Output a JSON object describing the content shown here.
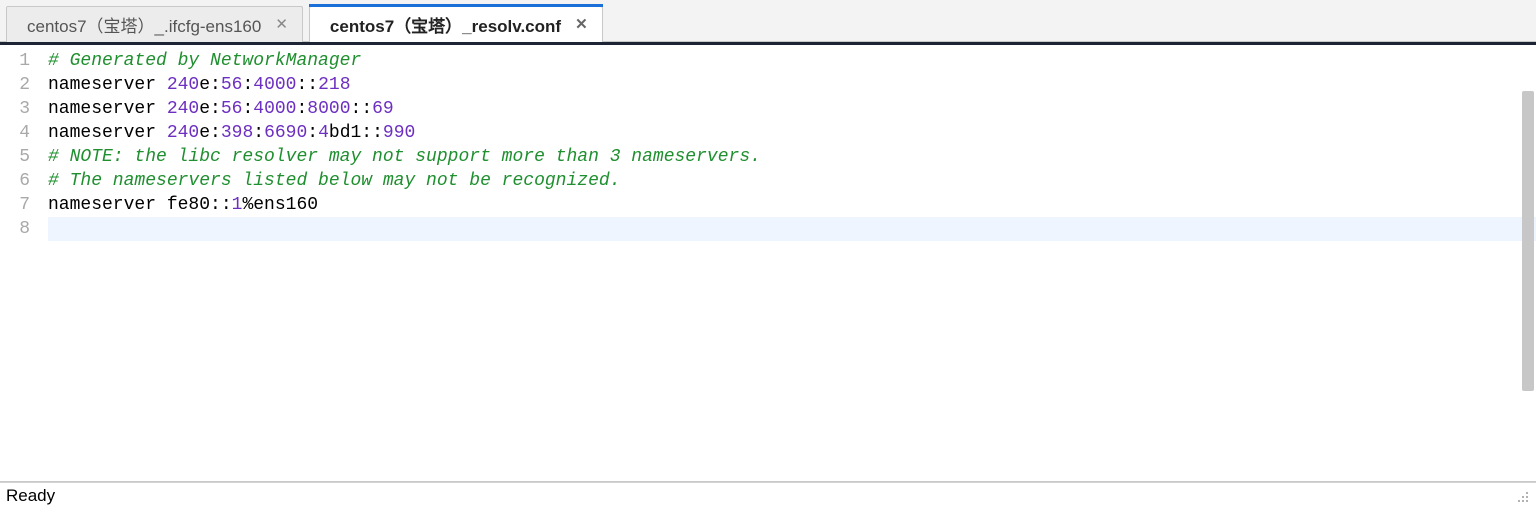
{
  "tabs": [
    {
      "label": "centos7（宝塔）_.ifcfg-ens160",
      "active": false
    },
    {
      "label": "centos7（宝塔）_resolv.conf",
      "active": true
    }
  ],
  "editor": {
    "lines": [
      {
        "n": 1,
        "tokens": [
          {
            "t": "# Generated by NetworkManager",
            "c": "comment"
          }
        ]
      },
      {
        "n": 2,
        "tokens": [
          {
            "t": "nameserver ",
            "c": "keyword"
          },
          {
            "t": "240",
            "c": "number"
          },
          {
            "t": "e:",
            "c": "text"
          },
          {
            "t": "56",
            "c": "number"
          },
          {
            "t": ":",
            "c": "text"
          },
          {
            "t": "4000",
            "c": "number"
          },
          {
            "t": "::",
            "c": "text"
          },
          {
            "t": "218",
            "c": "number"
          }
        ]
      },
      {
        "n": 3,
        "tokens": [
          {
            "t": "nameserver ",
            "c": "keyword"
          },
          {
            "t": "240",
            "c": "number"
          },
          {
            "t": "e:",
            "c": "text"
          },
          {
            "t": "56",
            "c": "number"
          },
          {
            "t": ":",
            "c": "text"
          },
          {
            "t": "4000",
            "c": "number"
          },
          {
            "t": ":",
            "c": "text"
          },
          {
            "t": "8000",
            "c": "number"
          },
          {
            "t": "::",
            "c": "text"
          },
          {
            "t": "69",
            "c": "number"
          }
        ]
      },
      {
        "n": 4,
        "tokens": [
          {
            "t": "nameserver ",
            "c": "keyword"
          },
          {
            "t": "240",
            "c": "number"
          },
          {
            "t": "e:",
            "c": "text"
          },
          {
            "t": "398",
            "c": "number"
          },
          {
            "t": ":",
            "c": "text"
          },
          {
            "t": "6690",
            "c": "number"
          },
          {
            "t": ":",
            "c": "text"
          },
          {
            "t": "4",
            "c": "number"
          },
          {
            "t": "bd1::",
            "c": "text"
          },
          {
            "t": "990",
            "c": "number"
          }
        ]
      },
      {
        "n": 5,
        "tokens": [
          {
            "t": "# NOTE: the libc resolver may not support more than 3 nameservers.",
            "c": "comment"
          }
        ]
      },
      {
        "n": 6,
        "tokens": [
          {
            "t": "# The nameservers listed below may not be recognized.",
            "c": "comment"
          }
        ]
      },
      {
        "n": 7,
        "tokens": [
          {
            "t": "nameserver fe80::",
            "c": "keyword"
          },
          {
            "t": "1",
            "c": "number"
          },
          {
            "t": "%ens160",
            "c": "text"
          }
        ]
      },
      {
        "n": 8,
        "tokens": [],
        "current": true
      }
    ]
  },
  "statusbar": {
    "text": "Ready"
  }
}
